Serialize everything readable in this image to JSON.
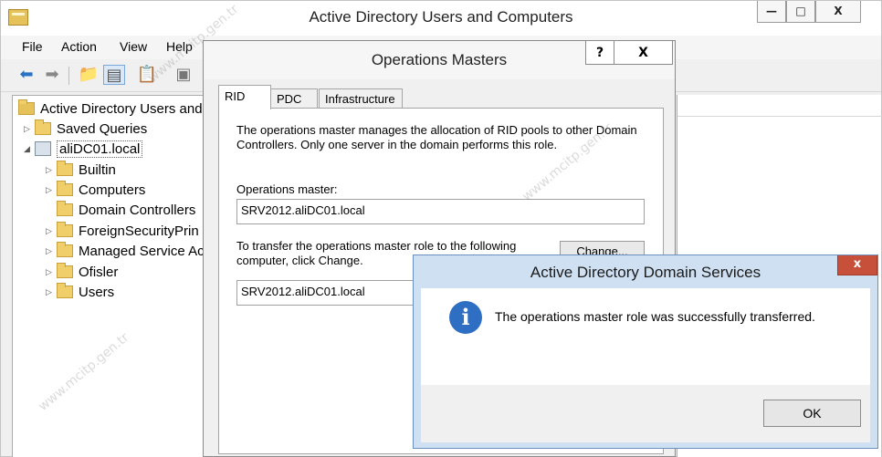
{
  "main_window": {
    "title": "Active Directory Users and Computers",
    "controls": {
      "min": "—",
      "max": "□",
      "close": "X"
    }
  },
  "menu": [
    "File",
    "Action",
    "View",
    "Help"
  ],
  "toolbar_icons": [
    "back-arrow-icon",
    "forward-arrow-icon",
    "folder-up-icon",
    "console-tree-icon",
    "clipboard-icon",
    "properties-icon"
  ],
  "tree": {
    "root": "Active Directory Users and C",
    "items": [
      {
        "label": "Saved Queries",
        "icon": "folder-icon"
      },
      {
        "label": "aliDC01.local",
        "icon": "domain-icon"
      },
      {
        "label": "Builtin",
        "icon": "folder-icon"
      },
      {
        "label": "Computers",
        "icon": "folder-icon"
      },
      {
        "label": "Domain Controllers",
        "icon": "folder-icon"
      },
      {
        "label": "ForeignSecurityPrin",
        "icon": "folder-icon"
      },
      {
        "label": "Managed Service Ac",
        "icon": "folder-icon"
      },
      {
        "label": "Ofisler",
        "icon": "folder-icon"
      },
      {
        "label": "Users",
        "icon": "folder-icon"
      }
    ]
  },
  "ops_dialog": {
    "title": "Operations Masters",
    "help": "?",
    "close": "X",
    "tabs": [
      "RID",
      "PDC",
      "Infrastructure"
    ],
    "description": "The operations master manages the allocation of RID pools to other Domain Controllers. Only one server in the domain performs this role.",
    "master_label": "Operations master:",
    "master_value": "SRV2012.aliDC01.local",
    "transfer_label": "To transfer the operations master role to the following computer, click Change.",
    "change_button": "Change...",
    "target_value": "SRV2012.aliDC01.local"
  },
  "msg_dialog": {
    "title": "Active Directory Domain Services",
    "close": "x",
    "message": "The operations master role was successfully transferred.",
    "ok": "OK"
  },
  "watermark": "www.mcitp.gen.tr"
}
